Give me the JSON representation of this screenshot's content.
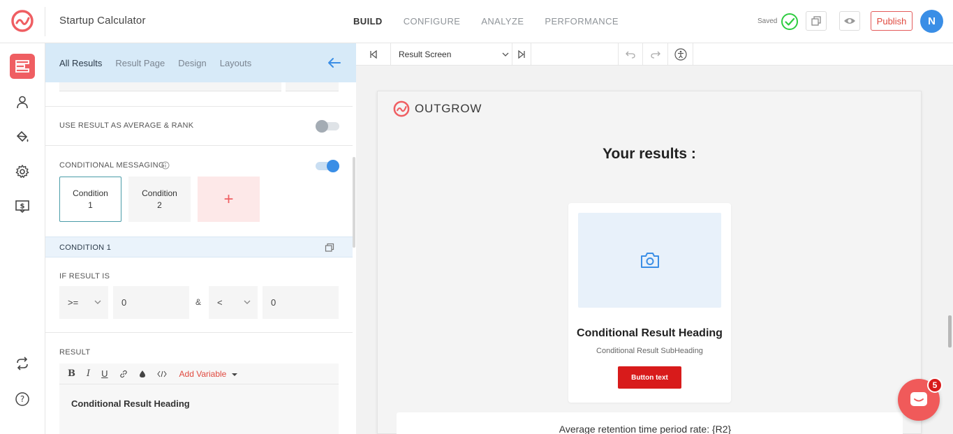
{
  "app": {
    "title": "Startup Calculator"
  },
  "topnav": {
    "items": [
      "BUILD",
      "CONFIGURE",
      "ANALYZE",
      "PERFORMANCE"
    ],
    "active": "BUILD"
  },
  "header": {
    "saved_label": "Saved",
    "publish_label": "Publish",
    "avatar_initial": "N"
  },
  "panel": {
    "tabs": [
      "All Results",
      "Result Page",
      "Design",
      "Layouts"
    ],
    "active_tab": "All Results",
    "use_result_label": "USE RESULT AS AVERAGE & RANK",
    "use_result_enabled": false,
    "conditional_label": "CONDITIONAL MESSAGING",
    "conditional_enabled": true,
    "conditions": [
      {
        "line1": "Condition",
        "line2": "1"
      },
      {
        "line1": "Condition",
        "line2": "2"
      }
    ],
    "add_symbol": "+",
    "condition_bar_label": "CONDITION 1",
    "if_result_label": "IF RESULT IS",
    "op1": ">=",
    "val1": "0",
    "joiner": "&",
    "op2": "<",
    "val2": "0",
    "result_label": "RESULT",
    "toolbar": {
      "bold": "B",
      "italic": "I",
      "underline": "U",
      "add_variable": "Add Variable"
    },
    "editor_content": "Conditional Result Heading"
  },
  "preview_toolbar": {
    "screen_select": "Result Screen"
  },
  "preview": {
    "brand": "OUTGROW",
    "results_title": "Your results :",
    "result_heading": "Conditional Result Heading",
    "result_subheading": "Conditional Result SubHeading",
    "button_text": "Button text",
    "avg_text": "Average retention time period rate: {R2}"
  },
  "chat": {
    "badge_count": "5"
  },
  "colors": {
    "accent": "#ef5e62",
    "primary": "#3a8ee6",
    "button": "#d81b1b",
    "success": "#2ecc40"
  }
}
